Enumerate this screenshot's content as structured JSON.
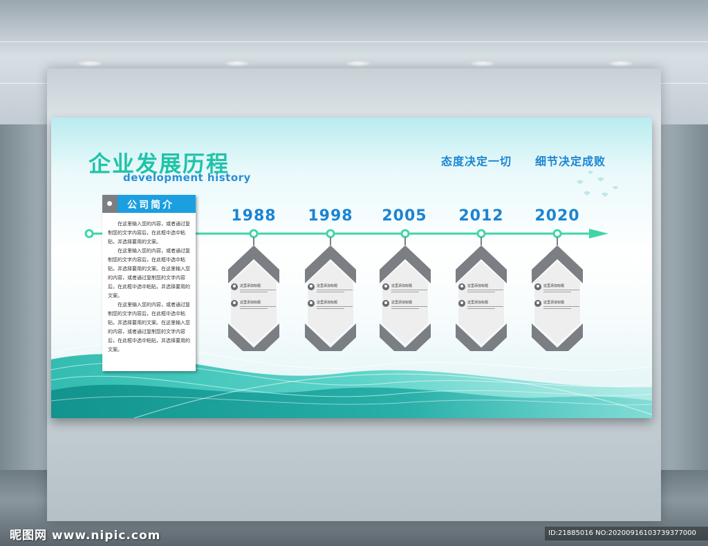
{
  "header": {
    "title_cn": "企业发展历程",
    "title_en": "development history",
    "slogan_left": "态度决定一切",
    "slogan_right": "细节决定成败"
  },
  "intro": {
    "title": "公司简介",
    "paragraphs": [
      "在这里输入您的内容，或者通过复制您的文字内容后，在此框中选中粘贴，并选择要用的文案。",
      "在这里输入您的内容，或者通过复制您的文字内容后，在此框中选中粘贴，并选择要用的文案。在这里输入您的内容，或者通过复制您的文字内容后，在此框中选中粘贴，并选择要用的文案。",
      "在这里输入您的内容，或者通过复制您的文字内容后，在此框中选中粘贴，并选择要用的文案。在这里输入您的内容，或者通过复制您的文字内容后，在此框中选中粘贴，并选择要用的文案。"
    ]
  },
  "timeline": {
    "milestones": [
      {
        "year": "1988",
        "row1": "这里添加标题",
        "row2": "这里添加标题"
      },
      {
        "year": "1998",
        "row1": "这里添加标题",
        "row2": "这里添加标题"
      },
      {
        "year": "2005",
        "row1": "这里添加标题",
        "row2": "这里添加标题"
      },
      {
        "year": "2012",
        "row1": "这里添加标题",
        "row2": "这里添加标题"
      },
      {
        "year": "2020",
        "row1": "这里添加标题",
        "row2": "这里添加标题"
      }
    ]
  },
  "footer": {
    "watermark": "昵图网 www.nipic.com",
    "id_text": "ID:21885016 NO:20200916103739377000"
  },
  "colors": {
    "accent_green": "#3fd6a6",
    "title_green": "#20c3a8",
    "accent_blue": "#1b84d2",
    "intro_blue": "#1b9fe0",
    "chevron_gray": "#7b7e82"
  },
  "icons": [
    "user-icon",
    "bird-icon",
    "arrow-right-icon"
  ]
}
